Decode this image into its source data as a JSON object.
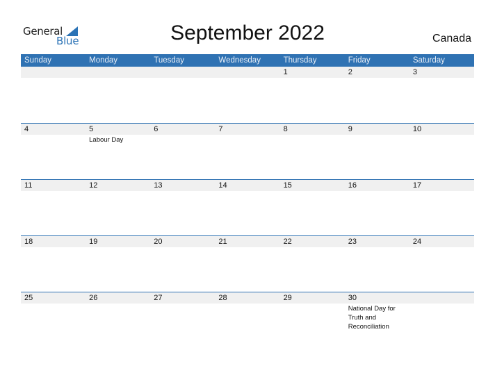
{
  "logo": {
    "word1": "General",
    "word2": "Blue"
  },
  "header": {
    "title": "September 2022",
    "country": "Canada"
  },
  "weekdays": [
    "Sunday",
    "Monday",
    "Tuesday",
    "Wednesday",
    "Thursday",
    "Friday",
    "Saturday"
  ],
  "weeks": [
    [
      {
        "d": ""
      },
      {
        "d": ""
      },
      {
        "d": ""
      },
      {
        "d": ""
      },
      {
        "d": "1"
      },
      {
        "d": "2"
      },
      {
        "d": "3"
      }
    ],
    [
      {
        "d": "4"
      },
      {
        "d": "5",
        "h": "Labour Day"
      },
      {
        "d": "6"
      },
      {
        "d": "7"
      },
      {
        "d": "8"
      },
      {
        "d": "9"
      },
      {
        "d": "10"
      }
    ],
    [
      {
        "d": "11"
      },
      {
        "d": "12"
      },
      {
        "d": "13"
      },
      {
        "d": "14"
      },
      {
        "d": "15"
      },
      {
        "d": "16"
      },
      {
        "d": "17"
      }
    ],
    [
      {
        "d": "18"
      },
      {
        "d": "19"
      },
      {
        "d": "20"
      },
      {
        "d": "21"
      },
      {
        "d": "22"
      },
      {
        "d": "23"
      },
      {
        "d": "24"
      }
    ],
    [
      {
        "d": "25"
      },
      {
        "d": "26"
      },
      {
        "d": "27"
      },
      {
        "d": "28"
      },
      {
        "d": "29"
      },
      {
        "d": "30",
        "h": "National Day for Truth and Reconciliation"
      },
      {
        "d": ""
      }
    ]
  ],
  "colors": {
    "accent": "#2f72b3",
    "date_row_bg": "#f0f0f0"
  }
}
